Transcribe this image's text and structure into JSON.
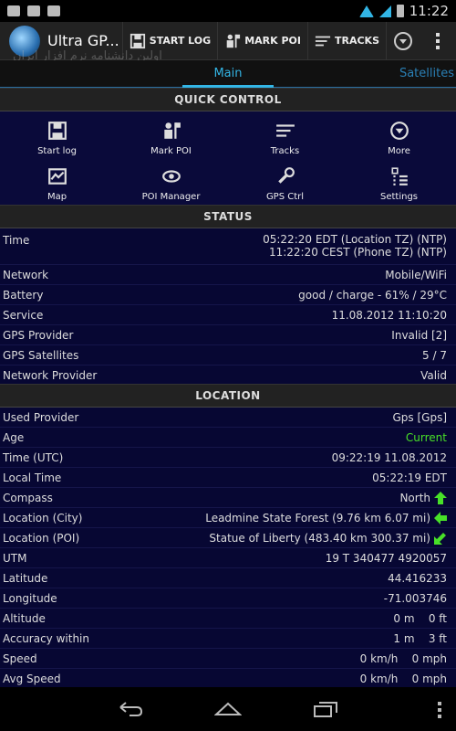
{
  "status_bar": {
    "time": "11:22"
  },
  "action_bar": {
    "title": "Ultra GP...",
    "watermark": "اولین دانشنامه نرم افزار ایران",
    "buttons": [
      {
        "label": "START LOG",
        "icon": "floppy-icon"
      },
      {
        "label": "MARK POI",
        "icon": "person-flag-icon"
      },
      {
        "label": "TRACKS",
        "icon": "tracks-icon"
      }
    ]
  },
  "tabs": {
    "main": "Main",
    "satellites": "Satellites"
  },
  "quick_control": {
    "header": "QUICK CONTROL",
    "items": [
      {
        "label": "Start log",
        "icon": "floppy-icon"
      },
      {
        "label": "Mark POI",
        "icon": "person-flag-icon"
      },
      {
        "label": "Tracks",
        "icon": "tracks-icon"
      },
      {
        "label": "More",
        "icon": "circle-chevron-icon"
      },
      {
        "label": "Map",
        "icon": "map-icon"
      },
      {
        "label": "POI Manager",
        "icon": "eye-icon"
      },
      {
        "label": "GPS Ctrl",
        "icon": "wrench-icon"
      },
      {
        "label": "Settings",
        "icon": "settings-list-icon"
      }
    ]
  },
  "status": {
    "header": "STATUS",
    "time": {
      "label": "Time",
      "line1": "05:22:20 EDT (Location TZ) (NTP)",
      "line2": "11:22:20 CEST (Phone TZ) (NTP)"
    },
    "rows": [
      {
        "label": "Network",
        "value": "Mobile/WiFi"
      },
      {
        "label": "Battery",
        "value": "good / charge - 61% / 29°C"
      },
      {
        "label": "Service",
        "value": "11.08.2012 11:10:20"
      },
      {
        "label": "GPS Provider",
        "value": "Invalid [2]"
      },
      {
        "label": "GPS Satellites",
        "value": "5 / 7"
      },
      {
        "label": "Network Provider",
        "value": "Valid"
      }
    ]
  },
  "location": {
    "header": "LOCATION",
    "rows": [
      {
        "label": "Used Provider",
        "value": "Gps [Gps]"
      },
      {
        "label": "Age",
        "value": "Current"
      },
      {
        "label": "Time (UTC)",
        "value": "09:22:19 11.08.2012"
      },
      {
        "label": "Local Time",
        "value": "05:22:19 EDT"
      },
      {
        "label": "Compass",
        "value": "North"
      },
      {
        "label": "Location (City)",
        "value": "Leadmine State Forest (9.76 km 6.07 mi)"
      },
      {
        "label": "Location (POI)",
        "value": "Statue of Liberty (483.40 km 300.37 mi)"
      },
      {
        "label": "UTM",
        "value": "19 T 340477 4920057"
      },
      {
        "label": "Latitude",
        "value": "44.416233"
      },
      {
        "label": "Longitude",
        "value": "-71.003746"
      },
      {
        "label": "Altitude",
        "value": "0 m    0 ft"
      },
      {
        "label": "Accuracy within",
        "value": "1 m    3 ft"
      },
      {
        "label": "Speed",
        "value": "0 km/h    0 mph"
      },
      {
        "label": "Avg Speed",
        "value": "0 km/h    0 mph"
      }
    ]
  },
  "colors": {
    "accent": "#33b5e5",
    "current": "#48e028",
    "panel": "#070733"
  }
}
